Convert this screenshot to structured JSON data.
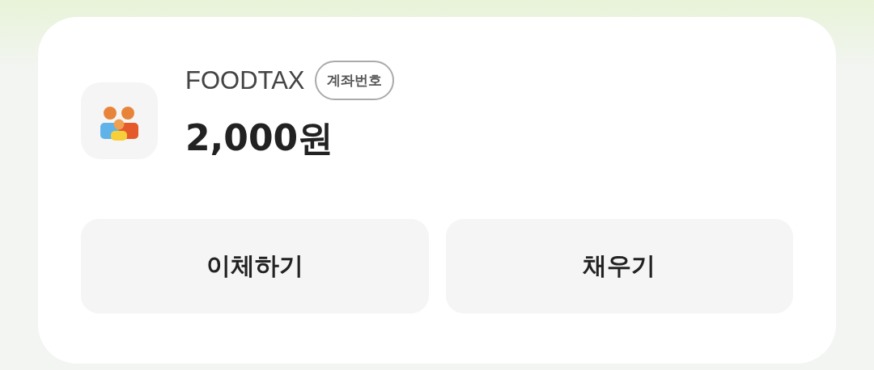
{
  "account": {
    "name": "FOODTAX",
    "badge": "계좌번호",
    "balance": "2,000원"
  },
  "buttons": [
    {
      "label": "이체하기"
    },
    {
      "label": "채우기"
    }
  ]
}
